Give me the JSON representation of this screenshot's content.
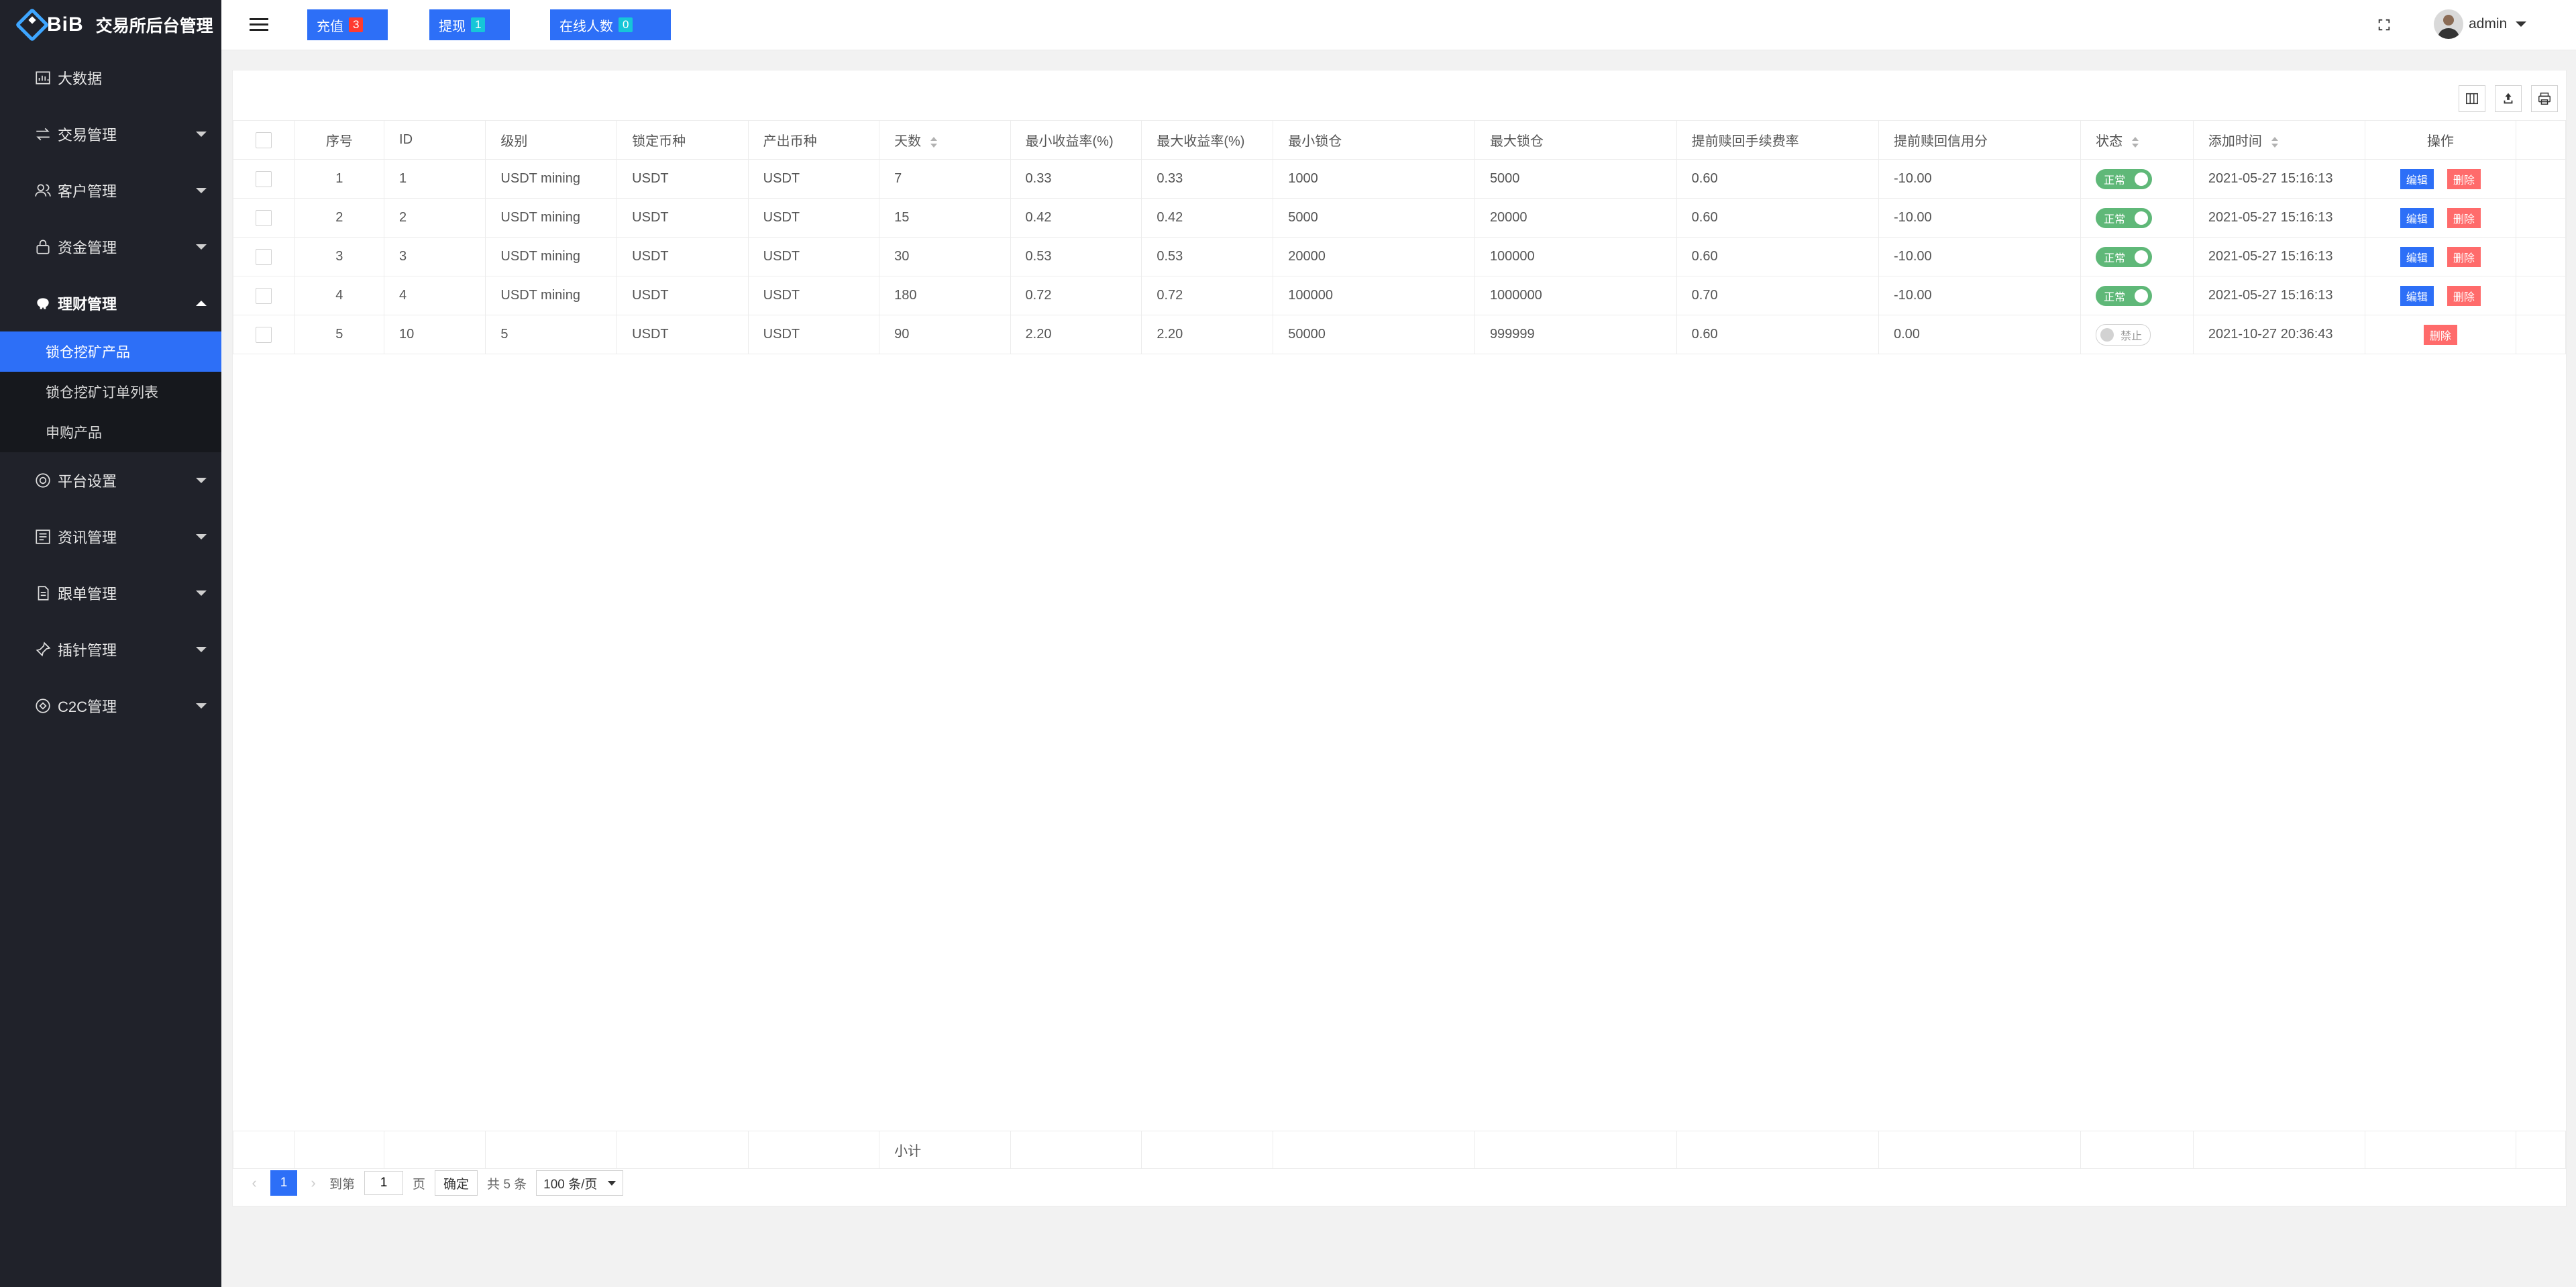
{
  "brand": {
    "logo_text": "BiB",
    "title": "交易所后台管理"
  },
  "sidebar": {
    "items": [
      {
        "label": "大数据",
        "icon": "chart-icon"
      },
      {
        "label": "交易管理",
        "icon": "exchange-icon"
      },
      {
        "label": "客户管理",
        "icon": "users-icon"
      },
      {
        "label": "资金管理",
        "icon": "lock-icon"
      },
      {
        "label": "理财管理",
        "icon": "piggy-bank-icon",
        "open": true
      },
      {
        "label": "平台设置",
        "icon": "settings-icon"
      },
      {
        "label": "资讯管理",
        "icon": "news-icon"
      },
      {
        "label": "跟单管理",
        "icon": "document-icon"
      },
      {
        "label": "插针管理",
        "icon": "pin-icon"
      },
      {
        "label": "C2C管理",
        "icon": "c2c-icon"
      }
    ],
    "submenu": [
      {
        "label": "锁仓挖矿产品",
        "active": true
      },
      {
        "label": "锁仓挖矿订单列表"
      },
      {
        "label": "申购产品"
      }
    ]
  },
  "header": {
    "recharge": {
      "label": "充值",
      "count": "3"
    },
    "withdraw": {
      "label": "提现",
      "count": "1"
    },
    "online": {
      "label": "在线人数",
      "count": "0"
    },
    "user": "admin"
  },
  "table": {
    "columns": [
      "序号",
      "ID",
      "级别",
      "锁定币种",
      "产出币种",
      "天数",
      "最小收益率(%)",
      "最大收益率(%)",
      "最小锁仓",
      "最大锁仓",
      "提前赎回手续费率",
      "提前赎回信用分",
      "状态",
      "添加时间",
      "操作"
    ],
    "rows": [
      {
        "seq": "1",
        "id": "1",
        "level": "USDT mining",
        "lock": "USDT",
        "out": "USDT",
        "days": "7",
        "min_rate": "0.33",
        "max_rate": "0.33",
        "min_lock": "1000",
        "max_lock": "5000",
        "fee": "0.60",
        "credit": "-10.00",
        "status": "正常",
        "on": true,
        "time": "2021-05-27 15:16:13",
        "edit": "编辑",
        "del": "删除"
      },
      {
        "seq": "2",
        "id": "2",
        "level": "USDT mining",
        "lock": "USDT",
        "out": "USDT",
        "days": "15",
        "min_rate": "0.42",
        "max_rate": "0.42",
        "min_lock": "5000",
        "max_lock": "20000",
        "fee": "0.60",
        "credit": "-10.00",
        "status": "正常",
        "on": true,
        "time": "2021-05-27 15:16:13",
        "edit": "编辑",
        "del": "删除"
      },
      {
        "seq": "3",
        "id": "3",
        "level": "USDT mining",
        "lock": "USDT",
        "out": "USDT",
        "days": "30",
        "min_rate": "0.53",
        "max_rate": "0.53",
        "min_lock": "20000",
        "max_lock": "100000",
        "fee": "0.60",
        "credit": "-10.00",
        "status": "正常",
        "on": true,
        "time": "2021-05-27 15:16:13",
        "edit": "编辑",
        "del": "删除"
      },
      {
        "seq": "4",
        "id": "4",
        "level": "USDT mining",
        "lock": "USDT",
        "out": "USDT",
        "days": "180",
        "min_rate": "0.72",
        "max_rate": "0.72",
        "min_lock": "100000",
        "max_lock": "1000000",
        "fee": "0.70",
        "credit": "-10.00",
        "status": "正常",
        "on": true,
        "time": "2021-05-27 15:16:13",
        "edit": "编辑",
        "del": "删除"
      },
      {
        "seq": "5",
        "id": "10",
        "level": "5",
        "lock": "USDT",
        "out": "USDT",
        "days": "90",
        "min_rate": "2.20",
        "max_rate": "2.20",
        "min_lock": "50000",
        "max_lock": "999999",
        "fee": "0.60",
        "credit": "0.00",
        "status": "禁止",
        "on": false,
        "time": "2021-10-27 20:36:43",
        "edit": "",
        "del": "删除"
      }
    ],
    "subtotal_label": "小计"
  },
  "pager": {
    "current_page": "1",
    "goto_label": "到第",
    "goto_value": "1",
    "page_unit": "页",
    "confirm": "确定",
    "total": "共 5 条",
    "page_size": "100 条/页"
  }
}
